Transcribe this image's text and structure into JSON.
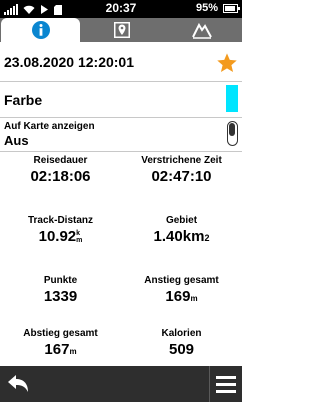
{
  "status_bar": {
    "time": "20:37",
    "battery_percent": "95%",
    "battery_level": 0.95
  },
  "tabs": [
    {
      "icon": "info-icon",
      "active": true
    },
    {
      "icon": "map-marker-icon",
      "active": false
    },
    {
      "icon": "elevation-icon",
      "active": false
    }
  ],
  "header": {
    "datetime": "23.08.2020 12:20:01",
    "favorite": true
  },
  "color_field": {
    "label": "Farbe",
    "color": "#00e5ff"
  },
  "map_field": {
    "label": "Auf Karte anzeigen",
    "value": "Aus"
  },
  "stats": [
    {
      "label": "Reisedauer",
      "value": "02:18:06"
    },
    {
      "label": "Verstrichene Zeit",
      "value": "02:47:10"
    },
    {
      "label": "Track-Distanz",
      "value": "10.92",
      "unit_top": "k",
      "unit_bottom": "m"
    },
    {
      "label": "Gebiet",
      "value": "1.40",
      "unit": "km",
      "unit_sup": "2"
    },
    {
      "label": "Punkte",
      "value": "1339"
    },
    {
      "label": "Anstieg gesamt",
      "value": "169",
      "unit": "m"
    },
    {
      "label": "Abstieg gesamt",
      "value": "167",
      "unit": "m"
    },
    {
      "label": "Kalorien",
      "value": "509"
    }
  ],
  "colors": {
    "accent": "#0a86d0",
    "star": "#f39a1e",
    "tab_bar": "#6e6e6e",
    "bottom_bar": "#2e2e2e"
  }
}
